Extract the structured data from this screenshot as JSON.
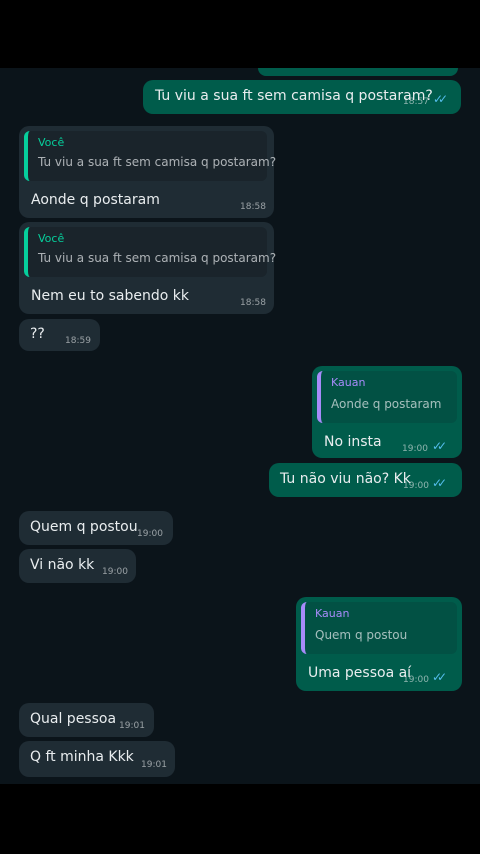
{
  "messages": [
    {
      "dir": "out",
      "text": "Tu viu a sua ft sem camisa q postaram?",
      "time": "18:57"
    },
    {
      "dir": "in",
      "quote_author": "Você",
      "quote_text": "Tu viu a sua ft sem camisa q postaram?",
      "text": "Aonde q postaram",
      "time": "18:58"
    },
    {
      "dir": "in",
      "quote_author": "Você",
      "quote_text": "Tu viu a sua ft sem camisa q postaram?",
      "text": "Nem eu to sabendo kk",
      "time": "18:58"
    },
    {
      "dir": "in",
      "text": "??",
      "time": "18:59"
    },
    {
      "dir": "out",
      "quote_author": "Kauan",
      "quote_text": "Aonde q postaram",
      "text": "No insta",
      "time": "19:00"
    },
    {
      "dir": "out",
      "text": "Tu não viu não? Kk",
      "time": "19:00"
    },
    {
      "dir": "in",
      "text": "Quem q postou",
      "time": "19:00"
    },
    {
      "dir": "in",
      "text": "Vi não kk",
      "time": "19:00"
    },
    {
      "dir": "out",
      "quote_author": "Kauan",
      "quote_text": "Quem q postou",
      "text": "Uma pessoa aí",
      "time": "19:00"
    },
    {
      "dir": "in",
      "text": "Qual pessoa",
      "time": "19:01"
    },
    {
      "dir": "in",
      "text": "Q ft minha Kkk",
      "time": "19:01"
    }
  ],
  "icons": {
    "read_receipt": "double-check-icon"
  },
  "colors": {
    "outgoing": "#005c4b",
    "incoming": "#1f2c34",
    "background": "#0b141a",
    "read_tick": "#53bdeb"
  }
}
